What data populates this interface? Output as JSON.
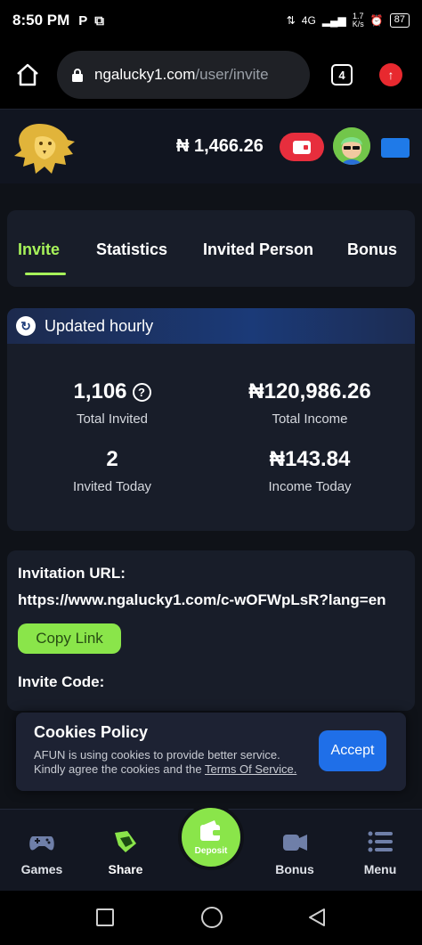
{
  "status_bar": {
    "time": "8:50 PM",
    "app_icons": [
      "P",
      "⧉"
    ],
    "network": "4G",
    "speed_value": "1.7",
    "speed_unit": "K/s",
    "battery": "87"
  },
  "browser": {
    "url_host": "ngalucky1.com",
    "url_path": "/user/invite",
    "tab_count": "4"
  },
  "header": {
    "balance": "₦ 1,466.26",
    "accent_color": "#e72e3d"
  },
  "tabs": [
    {
      "label": "Invite",
      "active": true
    },
    {
      "label": "Statistics"
    },
    {
      "label": "Invited Person"
    },
    {
      "label": "Bonus"
    }
  ],
  "stats": {
    "header_label": "Updated hourly",
    "total_invited": {
      "value": "1,106",
      "label": "Total Invited"
    },
    "total_income": {
      "value": "₦120,986.26",
      "label": "Total Income"
    },
    "invited_today": {
      "value": "2",
      "label": "Invited Today"
    },
    "income_today": {
      "value": "₦143.84",
      "label": "Income Today"
    }
  },
  "invite": {
    "url_label": "Invitation URL:",
    "url": "https://www.ngalucky1.com/c-wOFWpLsR?lang=en",
    "copy_label": "Copy Link",
    "code_label": "Invite Code:"
  },
  "cookie": {
    "title": "Cookies Policy",
    "text_line1": "AFUN is using cookies to provide better service.",
    "text_line2_prefix": "Kindly agree the cookies and the ",
    "link": "Terms Of Service.",
    "accept": "Accept"
  },
  "bottom_nav": {
    "games": "Games",
    "share": "Share",
    "deposit": "Deposit",
    "bonus": "Bonus",
    "menu": "Menu"
  },
  "colors": {
    "brand_green": "#a7f25a",
    "button_blue": "#1f6fe8",
    "wallet_red": "#e72e3d"
  }
}
